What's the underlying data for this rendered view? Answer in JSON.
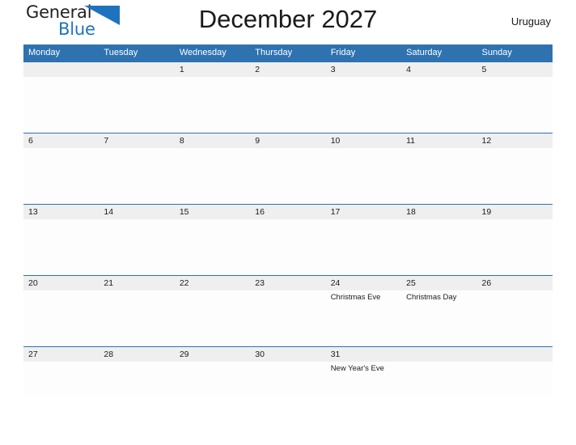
{
  "brand": {
    "name_top": "General",
    "name_bottom": "Blue",
    "triangle_icon": "blue-triangle-icon",
    "accent_color": "#1e73be"
  },
  "header": {
    "title": "December 2027",
    "region": "Uruguay"
  },
  "calendar": {
    "header_bg": "#2e72b0",
    "date_strip_bg": "#efefef",
    "body_bg": "#fdfdfd",
    "day_names": [
      "Monday",
      "Tuesday",
      "Wednesday",
      "Thursday",
      "Friday",
      "Saturday",
      "Sunday"
    ],
    "weeks": [
      {
        "dates": [
          "",
          "",
          "1",
          "2",
          "3",
          "4",
          "5"
        ],
        "events": [
          "",
          "",
          "",
          "",
          "",
          "",
          ""
        ]
      },
      {
        "dates": [
          "6",
          "7",
          "8",
          "9",
          "10",
          "11",
          "12"
        ],
        "events": [
          "",
          "",
          "",
          "",
          "",
          "",
          ""
        ]
      },
      {
        "dates": [
          "13",
          "14",
          "15",
          "16",
          "17",
          "18",
          "19"
        ],
        "events": [
          "",
          "",
          "",
          "",
          "",
          "",
          ""
        ]
      },
      {
        "dates": [
          "20",
          "21",
          "22",
          "23",
          "24",
          "25",
          "26"
        ],
        "events": [
          "",
          "",
          "",
          "",
          "Christmas Eve",
          "Christmas Day",
          ""
        ]
      },
      {
        "dates": [
          "27",
          "28",
          "29",
          "30",
          "31",
          "",
          ""
        ],
        "events": [
          "",
          "",
          "",
          "",
          "New Year's Eve",
          "",
          ""
        ]
      }
    ]
  }
}
